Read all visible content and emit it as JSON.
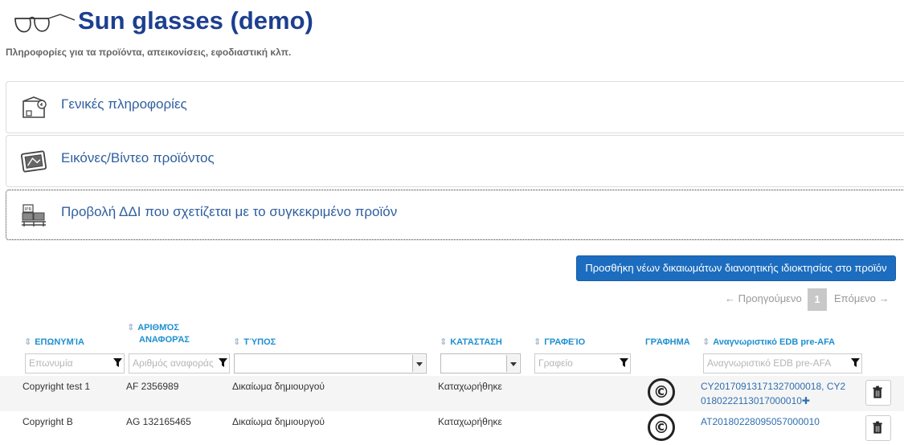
{
  "header": {
    "icon": "glasses-icon",
    "title": "Sun glasses (demo)",
    "subtitle": "Πληροφορίες για τα προϊόντα, απεικονίσεις, εφοδιαστική κλπ."
  },
  "sections": [
    {
      "icon": "box-info-icon",
      "label": "Γενικές πληροφορίες"
    },
    {
      "icon": "photo-icon",
      "label": "Εικόνες/Βίντεο προϊόντος"
    },
    {
      "icon": "ipr-pallet-icon",
      "label": "Προβολή ΔΔΙ που σχετίζεται με το συγκεκριμένο προϊόν"
    }
  ],
  "toolbar": {
    "add_label": "Προσθήκη νέων δικαιωμάτων διανοητικής ιδιοκτησίας στο προϊόν"
  },
  "pagination": {
    "prev_label": "← Προηγούμενο",
    "page": "1",
    "next_label": "Επόμενο →"
  },
  "table": {
    "columns": [
      {
        "line1": "ΕΠΩΝΥΜΊΑ",
        "line2": ""
      },
      {
        "line1": "ΑΡΙΘΜΌΣ",
        "line2": "ΑΝΑΦΟΡΆΣ"
      },
      {
        "line1": "ΤΎΠΟΣ",
        "line2": ""
      },
      {
        "line1": "ΚΑΤΆΣΤΑΣΗ",
        "line2": ""
      },
      {
        "line1": "ΓΡΑΦΕΊΟ",
        "line2": ""
      },
      {
        "line1": "ΓΡΆΦΗΜΑ",
        "line2": ""
      },
      {
        "line1": "Αναγνωριστικό EDB pre-AFA",
        "line2": ""
      }
    ],
    "filters": {
      "name_placeholder": "Επωνυμία",
      "ref_placeholder": "Αριθμός αναφοράς",
      "office_placeholder": "Γραφείο",
      "edb_placeholder": "Αναγνωριστικό EDB pre-AFA"
    },
    "rows": [
      {
        "name": "Copyright test 1",
        "ref": "AF 2356989",
        "type": "Δικαίωμα δημιουργού",
        "status": "Καταχωρήθηκε",
        "graphic": "©",
        "edb_line1": "CY20170913171327000018, CY2",
        "edb_line2": "0180222113017000010",
        "edb_more": "✚"
      },
      {
        "name": "Copyright B",
        "ref": "AG 132165465",
        "type": "Δικαίωμα δημιουργού",
        "status": "Καταχωρήθηκε",
        "graphic": "©",
        "edb_line1": "AT20180228095057000010"
      }
    ]
  },
  "colors": {
    "title": "#1d3f8f",
    "header_link": "#1d8fd0",
    "button": "#1c6dbf",
    "section_label": "#2f5f9e"
  }
}
